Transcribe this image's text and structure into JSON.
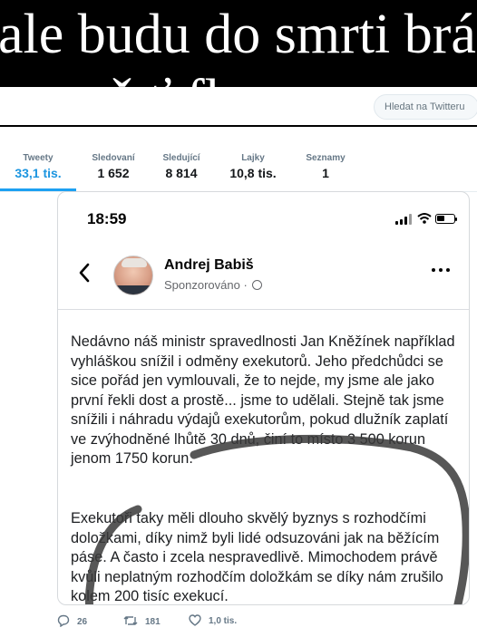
{
  "banner": {
    "line1": "ale budu do smrti brá",
    "line2": "ě           ť   fl"
  },
  "search": {
    "placeholder": "Hledat na Twitteru"
  },
  "stats": [
    {
      "label": "Tweety",
      "value": "33,1 tis."
    },
    {
      "label": "Sledovaní",
      "value": "1 652"
    },
    {
      "label": "Sledující",
      "value": "8 814"
    },
    {
      "label": "Lajky",
      "value": "10,8 tis."
    },
    {
      "label": "Seznamy",
      "value": "1"
    }
  ],
  "phone": {
    "time": "18:59",
    "author": "Andrej Babiš",
    "sponsored": "Sponzorováno ·",
    "paragraph1": "Nedávno náš ministr spravedlnosti Jan Kněžínek například vyhláškou snížil i odměny exekutorů. Jeho předchůdci se sice pořád jen vymlouvali, že to nejde, my jsme ale jako první řekli dost a prostě... jsme to udělali. Stejně tak jsme snížili i náhradu výdajů exekutorům, pokud dlužník zaplatí ve zvýhodněné lhůtě 30 dnů, činí to místo 3 500 korun jenom 1750 korun.",
    "paragraph2": "Exekutoři taky měli dlouho skvělý byznys s rozhodčími doložkami, díky nimž byli lidé odsuzováni jak na běžícím páse. A často i zcela nespravedlivě. Mimochodem právě kvůli neplatným rozhodčím doložkám se díky nám zrušilo kolem 200 tisíc exekucí."
  },
  "actions": {
    "replies": "26",
    "retweets": "181",
    "likes": "1,0 tis."
  },
  "colors": {
    "accent": "#1da1f2",
    "active_value": "#1b95e0",
    "muted": "#657786"
  },
  "icons": [
    "reply-icon",
    "retweet-icon",
    "like-icon",
    "back-arrow-icon",
    "more-icon",
    "globe-icon",
    "wifi-icon",
    "battery-icon",
    "signal-icon"
  ]
}
